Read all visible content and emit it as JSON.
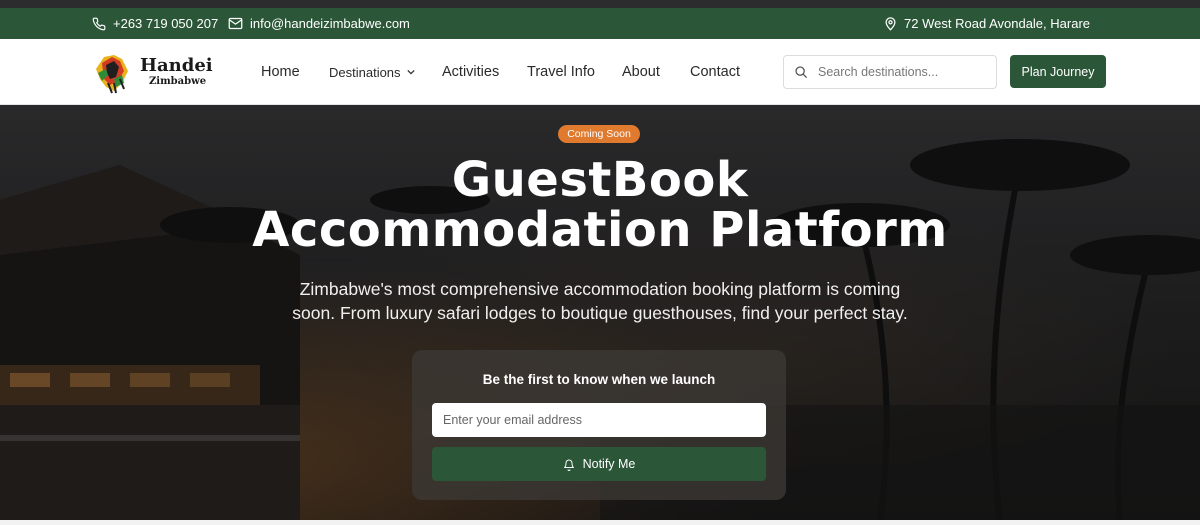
{
  "topbar": {
    "phone": "+263 719 050 207",
    "email": "info@handeizimbabwe.com",
    "address": "72 West Road Avondale, Harare",
    "icons": {
      "phone": "phone-icon",
      "email": "mail-icon",
      "address": "map-pin-icon"
    }
  },
  "brand": {
    "title": "Handei",
    "subtitle": "Zimbabwe",
    "colors": {
      "green": "#2b5738",
      "accent": "#e07a2e"
    }
  },
  "nav": {
    "home": "Home",
    "destinations": "Destinations",
    "activities": "Activities",
    "travel_info": "Travel Info",
    "about": "About",
    "contact": "Contact"
  },
  "search": {
    "placeholder": "Search destinations...",
    "icon": "search-icon"
  },
  "plan_button": "Plan Journey",
  "hero": {
    "badge": "Coming Soon",
    "title_line1": "GuestBook",
    "title_line2": "Accommodation Platform",
    "description_line1": "Zimbabwe's most comprehensive accommodation booking platform is coming",
    "description_line2": "soon. From luxury safari lodges to boutique guesthouses, find your perfect stay."
  },
  "notify": {
    "heading": "Be the first to know when we launch",
    "email_placeholder": "Enter your email address",
    "button": "Notify Me",
    "icon": "bell-icon"
  }
}
